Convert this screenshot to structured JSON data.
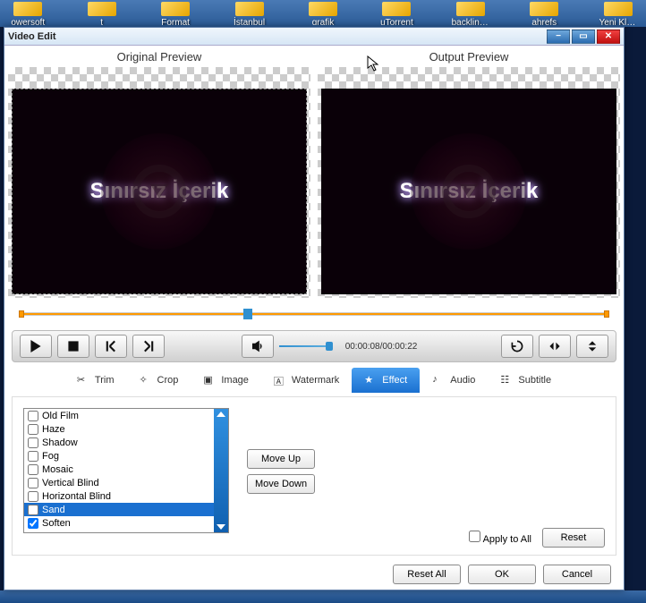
{
  "desktop_icons": [
    "owersoft",
    "t",
    "Format",
    "İstanbul",
    "grafik",
    "uTorrent",
    "backlink-d",
    "ahrefs",
    "Yeni Klasö"
  ],
  "window": {
    "title": "Video Edit",
    "original_label": "Original Preview",
    "output_label": "Output Preview",
    "watermark_text": "Sınırsız İçerik",
    "timecode": "00:00:08/00:00:22"
  },
  "tabs": [
    {
      "label": "Trim"
    },
    {
      "label": "Crop"
    },
    {
      "label": "Image"
    },
    {
      "label": "Watermark"
    },
    {
      "label": "Effect"
    },
    {
      "label": "Audio"
    },
    {
      "label": "Subtitle"
    }
  ],
  "effects": [
    {
      "label": "Old Film",
      "checked": false,
      "selected": false
    },
    {
      "label": "Haze",
      "checked": false,
      "selected": false
    },
    {
      "label": "Shadow",
      "checked": false,
      "selected": false
    },
    {
      "label": "Fog",
      "checked": false,
      "selected": false
    },
    {
      "label": "Mosaic",
      "checked": false,
      "selected": false
    },
    {
      "label": "Vertical Blind",
      "checked": false,
      "selected": false
    },
    {
      "label": "Horizontal Blind",
      "checked": false,
      "selected": false
    },
    {
      "label": "Sand",
      "checked": false,
      "selected": true
    },
    {
      "label": "Soften",
      "checked": true,
      "selected": false
    }
  ],
  "buttons": {
    "move_up": "Move Up",
    "move_down": "Move Down",
    "apply_all": "Apply to All",
    "reset": "Reset",
    "reset_all": "Reset All",
    "ok": "OK",
    "cancel": "Cancel"
  }
}
